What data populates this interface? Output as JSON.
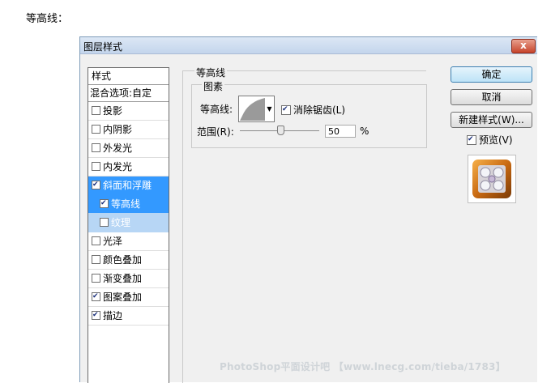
{
  "caption": "等高线：",
  "dialog": {
    "title": "图层样式",
    "close_glyph": "x",
    "styles_header": "样式",
    "blend_options": "混合选项:自定",
    "items": [
      {
        "label": "投影",
        "checked": false
      },
      {
        "label": "内阴影",
        "checked": false
      },
      {
        "label": "外发光",
        "checked": false
      },
      {
        "label": "内发光",
        "checked": false
      },
      {
        "label": "斜面和浮雕",
        "checked": true
      },
      {
        "label": "等高线",
        "checked": true
      },
      {
        "label": "纹理",
        "checked": false
      },
      {
        "label": "光泽",
        "checked": false
      },
      {
        "label": "颜色叠加",
        "checked": false
      },
      {
        "label": "渐变叠加",
        "checked": false
      },
      {
        "label": "图案叠加",
        "checked": true
      },
      {
        "label": "描边",
        "checked": true
      }
    ],
    "panel": {
      "group_title": "等高线",
      "subgroup_title": "图素",
      "contour_label": "等高线:",
      "antialias_label": "消除锯齿(L)",
      "antialias_checked": true,
      "range_label": "范围(R):",
      "range_value": "50",
      "range_unit": "%"
    },
    "buttons": {
      "ok": "确定",
      "cancel": "取消",
      "new_style": "新建样式(W)...",
      "preview": "预览(V)",
      "preview_checked": true
    }
  },
  "watermark": "PhotoShop平面设计吧 【www.lnecg.com/tieba/1783】",
  "colors": {
    "selection": "#3399ff",
    "sub_selection": "#b7d6f5",
    "accent_button": "#bde3f7"
  }
}
